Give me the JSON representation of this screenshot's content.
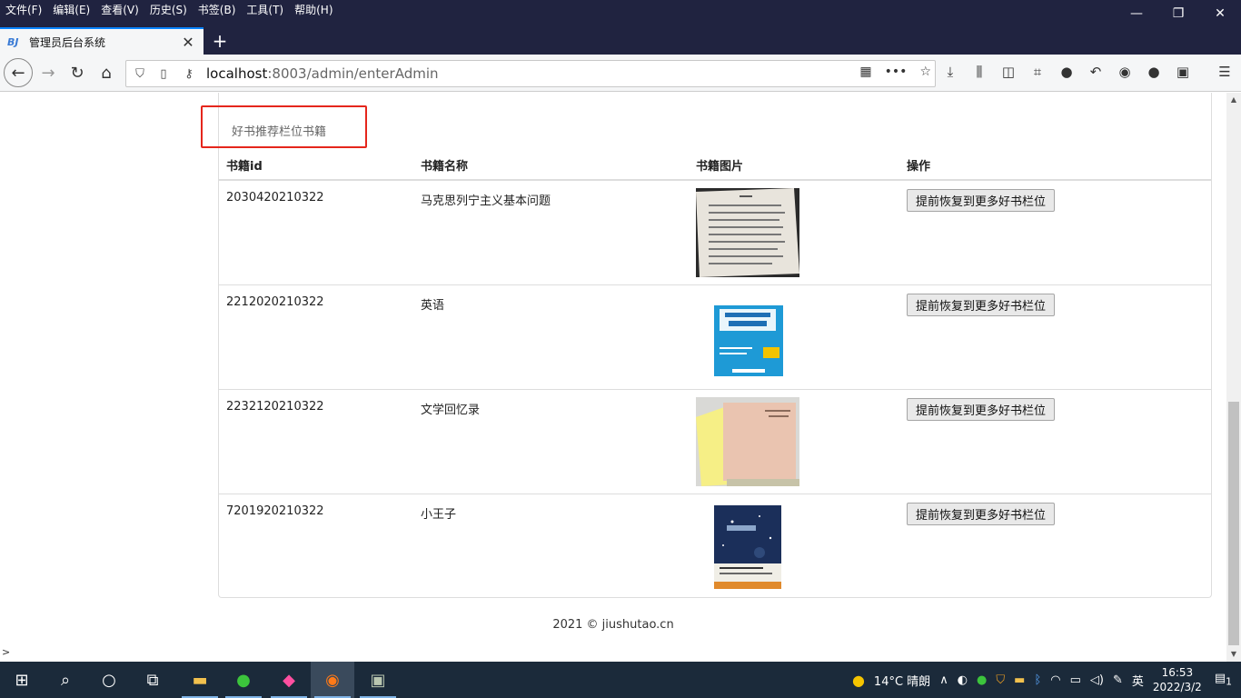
{
  "menu": {
    "items": [
      "文件(F)",
      "编辑(E)",
      "查看(V)",
      "历史(S)",
      "书签(B)",
      "工具(T)",
      "帮助(H)"
    ]
  },
  "tab": {
    "title": "管理员后台系统",
    "favicon_text": "BJ"
  },
  "url": {
    "host": "localhost",
    "rest": ":8003/admin/enterAdmin"
  },
  "panel": {
    "title": "好书推荐栏位书籍"
  },
  "table": {
    "headers": [
      "书籍id",
      "书籍名称",
      "书籍图片",
      "操作"
    ],
    "rows": [
      {
        "id": "2030420210322",
        "name": "马克思列宁主义基本问题",
        "action": "提前恢复到更多好书栏位",
        "image": "book-marx-photo"
      },
      {
        "id": "2212020210322",
        "name": "英语",
        "action": "提前恢复到更多好书栏位",
        "image": "book-english-cover"
      },
      {
        "id": "2232120210322",
        "name": "文学回忆录",
        "action": "提前恢复到更多好书栏位",
        "image": "book-literature-photo"
      },
      {
        "id": "7201920210322",
        "name": "小王子",
        "action": "提前恢复到更多好书栏位",
        "image": "book-little-prince-cover"
      }
    ]
  },
  "footer": {
    "text": "2021 © jiushutao.cn"
  },
  "statusbar": {
    "text": ">"
  },
  "taskbar": {
    "weather": "14°C  晴朗",
    "ime": "英",
    "time": "16:53",
    "date": "2022/3/2",
    "notification_count": "1"
  },
  "colors": {
    "highlight": "#e5261c",
    "firefox_dark": "#202340",
    "taskbar": "#1b2a3a"
  }
}
